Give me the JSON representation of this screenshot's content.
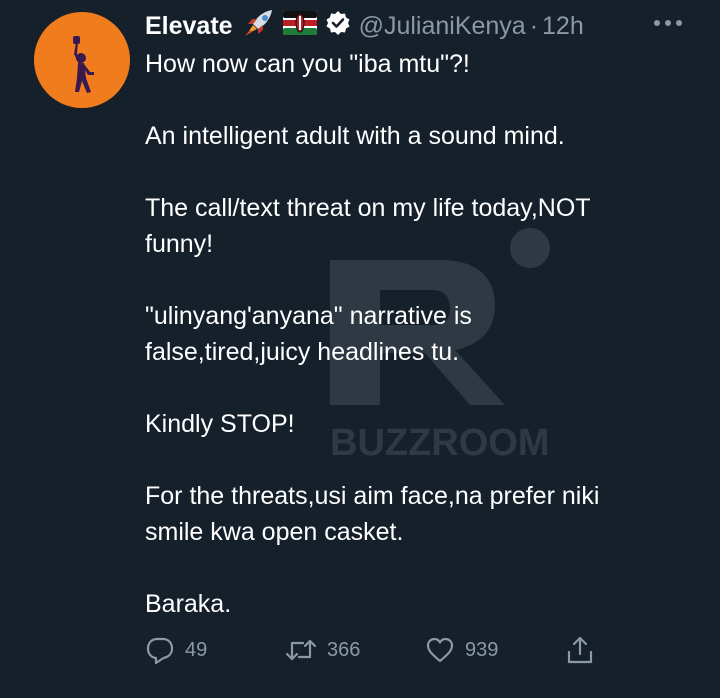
{
  "tweet": {
    "display_name": "Elevate",
    "name_emojis": [
      "rocket-icon",
      "kenya-flag-icon"
    ],
    "handle": "@JulianiKenya",
    "separator": "·",
    "time": "12h",
    "text_lines": [
      "How now can you \"iba mtu\"?!",
      "",
      "An intelligent adult with a sound mind.",
      "",
      "The call/text threat on my life today,NOT",
      "funny!",
      "",
      "\"ulinyang'anyana\" narrative is",
      "false,tired,juicy headlines tu.",
      "",
      "Kindly STOP!",
      "",
      "For the threats,usi aim face,na prefer niki",
      "smile kwa open casket.",
      "",
      "Baraka."
    ],
    "replies": "49",
    "retweets": "366",
    "likes": "939"
  },
  "watermark": {
    "text": "BUZZROOM"
  },
  "colors": {
    "background": "#15202b",
    "text": "#ffffff",
    "muted": "#8b98a5",
    "avatar": "#f07c1e"
  }
}
